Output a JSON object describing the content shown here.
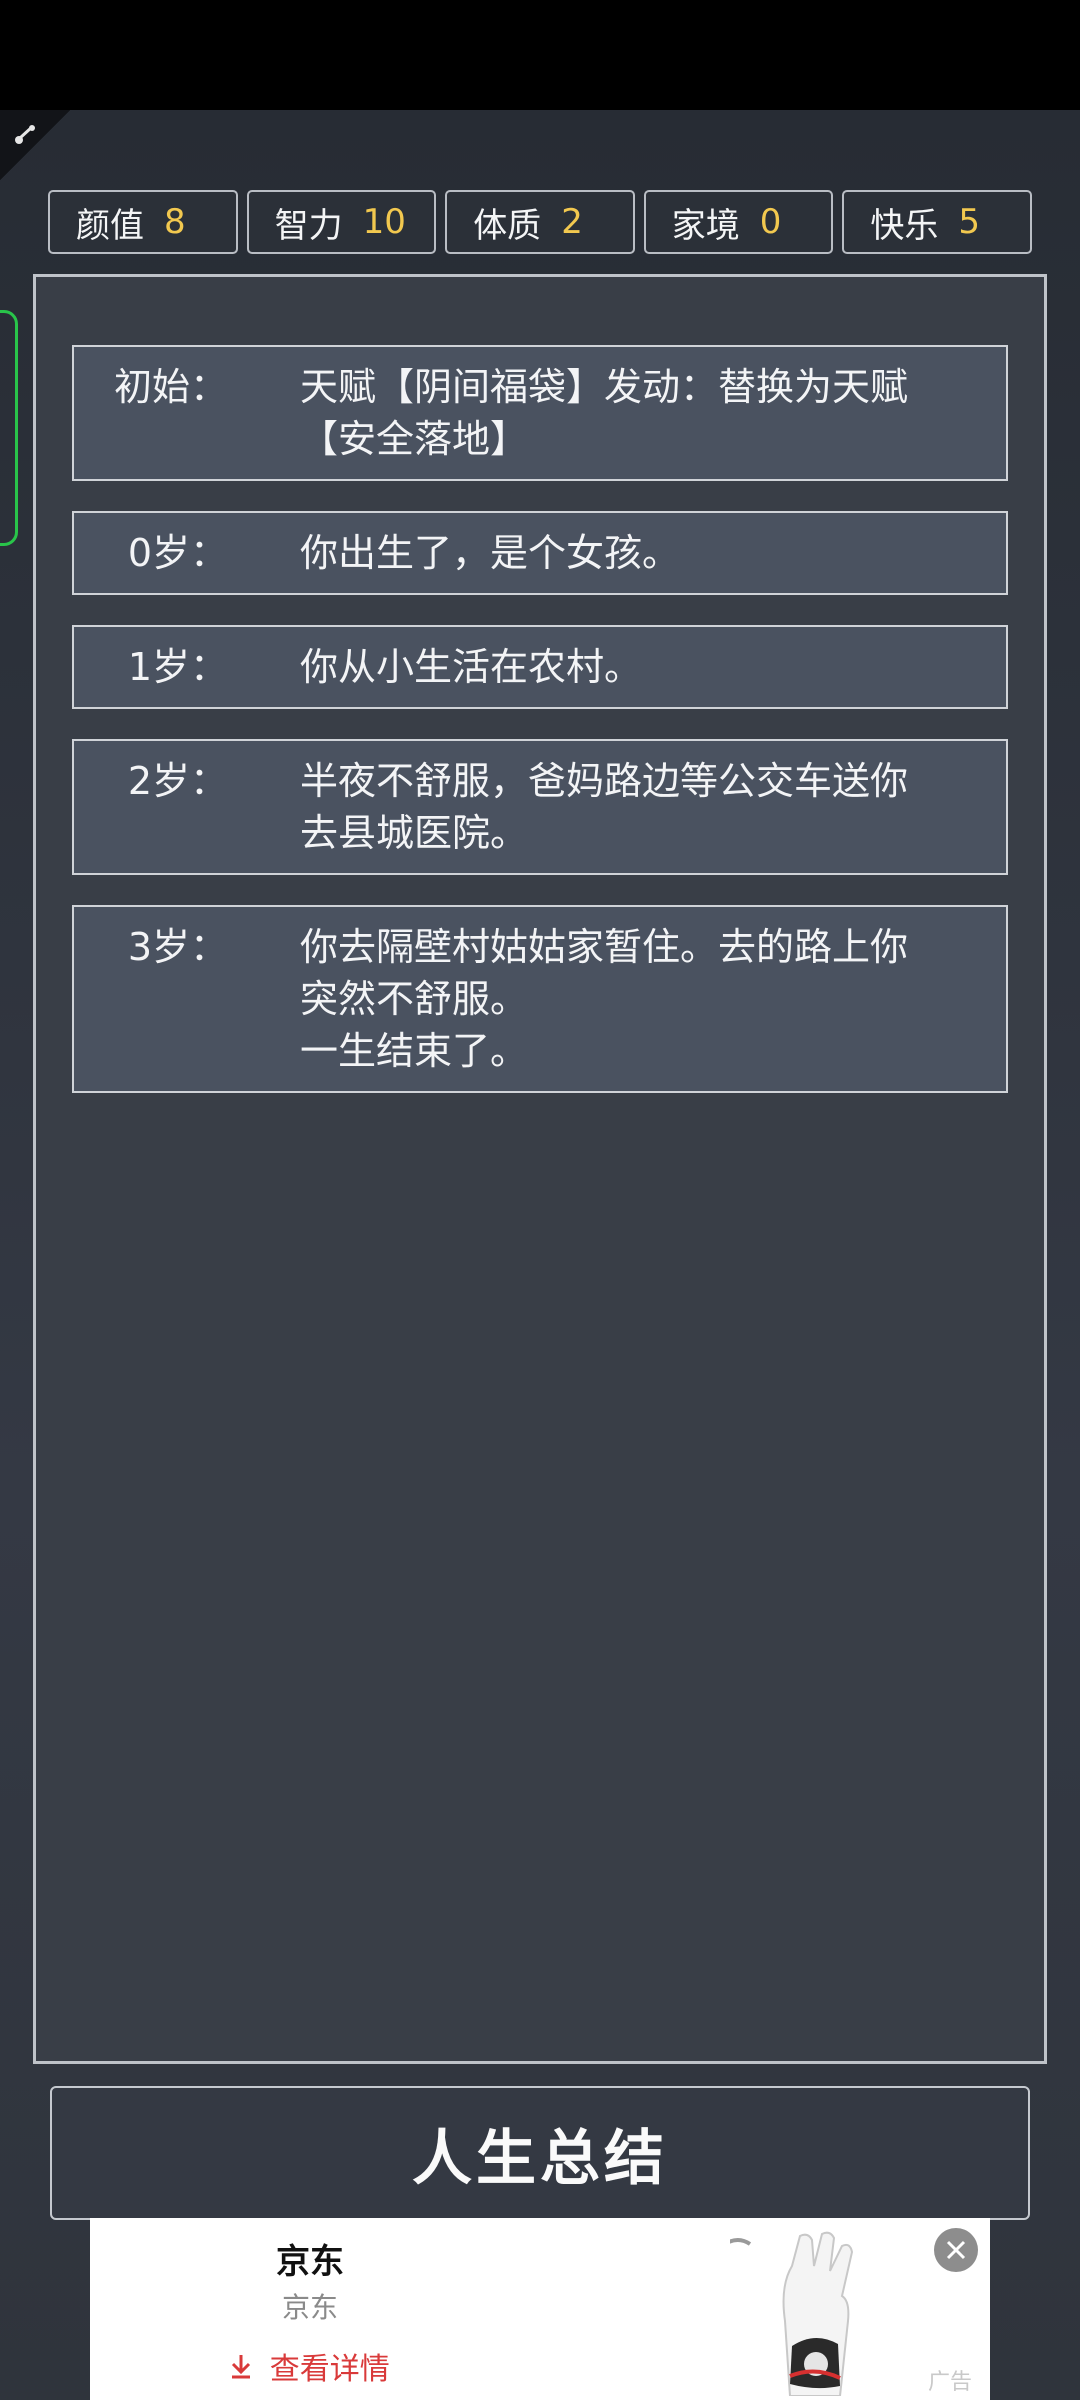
{
  "stats": [
    {
      "label": "颜值",
      "value": "8"
    },
    {
      "label": "智力",
      "value": "10"
    },
    {
      "label": "体质",
      "value": "2"
    },
    {
      "label": "家境",
      "value": "0"
    },
    {
      "label": "快乐",
      "value": "5"
    }
  ],
  "log": [
    {
      "age": "初始：",
      "text": "天赋【阴间福袋】发动：替换为天赋\n【安全落地】"
    },
    {
      "age": "0岁：",
      "text": "你出生了，是个女孩。"
    },
    {
      "age": "1岁：",
      "text": "你从小生活在农村。"
    },
    {
      "age": "2岁：",
      "text": "半夜不舒服，爸妈路边等公交车送你\n去县城医院。"
    },
    {
      "age": "3岁：",
      "text": "你去隔壁村姑姑家暂住。去的路上你\n突然不舒服。\n一生结束了。"
    }
  ],
  "summary_button": "人生总结",
  "ad": {
    "title": "京东",
    "subtitle": "京东",
    "link": "查看详情",
    "tag": "广告",
    "image_icon": "golf-glove-image",
    "colors": {
      "link": "#d93a3a",
      "close_bg": "#8d8d8d"
    }
  },
  "colors": {
    "stat_value": "#f2c84f",
    "accent_tab": "#29c44a",
    "entry_bg": "#4a5260"
  }
}
